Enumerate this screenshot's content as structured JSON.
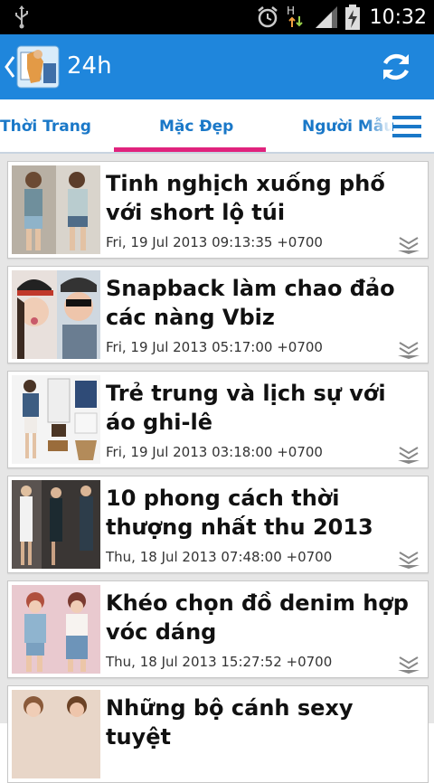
{
  "status": {
    "time": "10:32",
    "icons": [
      "usb-icon",
      "alarm-icon",
      "network-h-icon",
      "signal-icon",
      "battery-charging-icon"
    ]
  },
  "appbar": {
    "title": "24h",
    "icons": [
      "back-icon",
      "app-logo",
      "refresh-icon"
    ]
  },
  "tabs": {
    "items": [
      {
        "label": "Thời Trang"
      },
      {
        "label": "Mặc Đẹp"
      },
      {
        "label": "Người Mẫu"
      }
    ],
    "selected": 1,
    "menu_icon": "menu-icon",
    "accent_color": "#e0237d"
  },
  "articles": [
    {
      "title": "Tinh nghịch xuống phố với short lộ túi",
      "date": "Fri, 19 Jul 2013 09:13:35 +0700"
    },
    {
      "title": "Snapback làm chao đảo các nàng Vbiz",
      "date": "Fri, 19 Jul 2013 05:17:00 +0700"
    },
    {
      "title": "Trẻ trung và lịch sự với áo ghi-lê",
      "date": "Fri, 19 Jul 2013 03:18:00 +0700"
    },
    {
      "title": "10 phong cách thời thượng nhất thu 2013",
      "date": "Thu, 18 Jul 2013 07:48:00 +0700"
    },
    {
      "title": "Khéo chọn đồ denim hợp vóc dáng",
      "date": "Thu, 18 Jul 2013 15:27:52 +0700"
    },
    {
      "title": "Những bộ cánh sexy tuyệt",
      "date": ""
    }
  ],
  "colors": {
    "appbar": "#1f86dc",
    "tab_text": "#1a78c8",
    "list_bg": "#e6e6e6"
  }
}
